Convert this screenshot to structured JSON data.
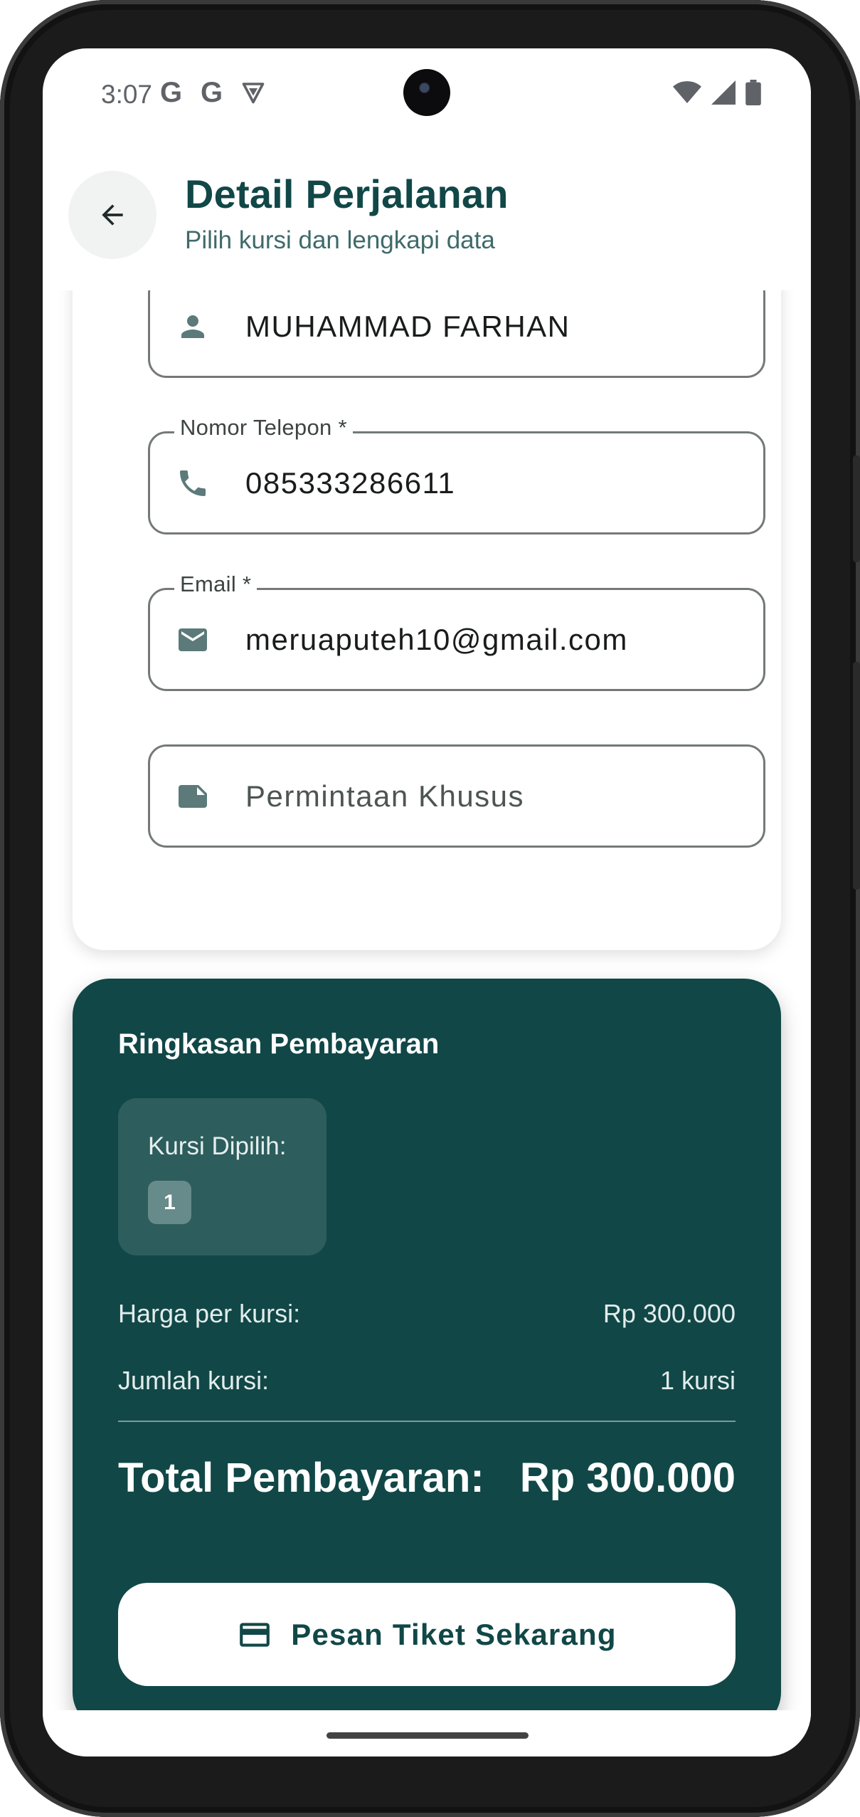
{
  "status_bar": {
    "time": "3:07",
    "notification_icons": [
      "G",
      "G"
    ]
  },
  "app_bar": {
    "title": "Detail Perjalanan",
    "subtitle": "Pilih kursi dan lengkapi data"
  },
  "form": {
    "name_value": "MUHAMMAD FARHAN",
    "phone_label": "Nomor Telepon *",
    "phone_value": "085333286611",
    "email_label": "Email *",
    "email_value": "meruaputeh10@gmail.com",
    "special_request_placeholder": "Permintaan Khusus"
  },
  "payment": {
    "heading": "Ringkasan Pembayaran",
    "seats_label": "Kursi Dipilih:",
    "selected_seats": [
      "1"
    ],
    "price_label": "Harga per kursi:",
    "price_value": "Rp 300.000",
    "count_label": "Jumlah kursi:",
    "count_value": "1 kursi",
    "total_label": "Total Pembayaran:",
    "total_value": "Rp 300.000",
    "order_button": "Pesan Tiket Sekarang"
  },
  "colors": {
    "brand": "#114747",
    "field_border": "#747978"
  },
  "icons": {
    "back": "arrow-left-icon",
    "name": "person-icon",
    "phone": "phone-icon",
    "email": "mail-icon",
    "note": "note-icon",
    "card": "credit-card-icon"
  }
}
